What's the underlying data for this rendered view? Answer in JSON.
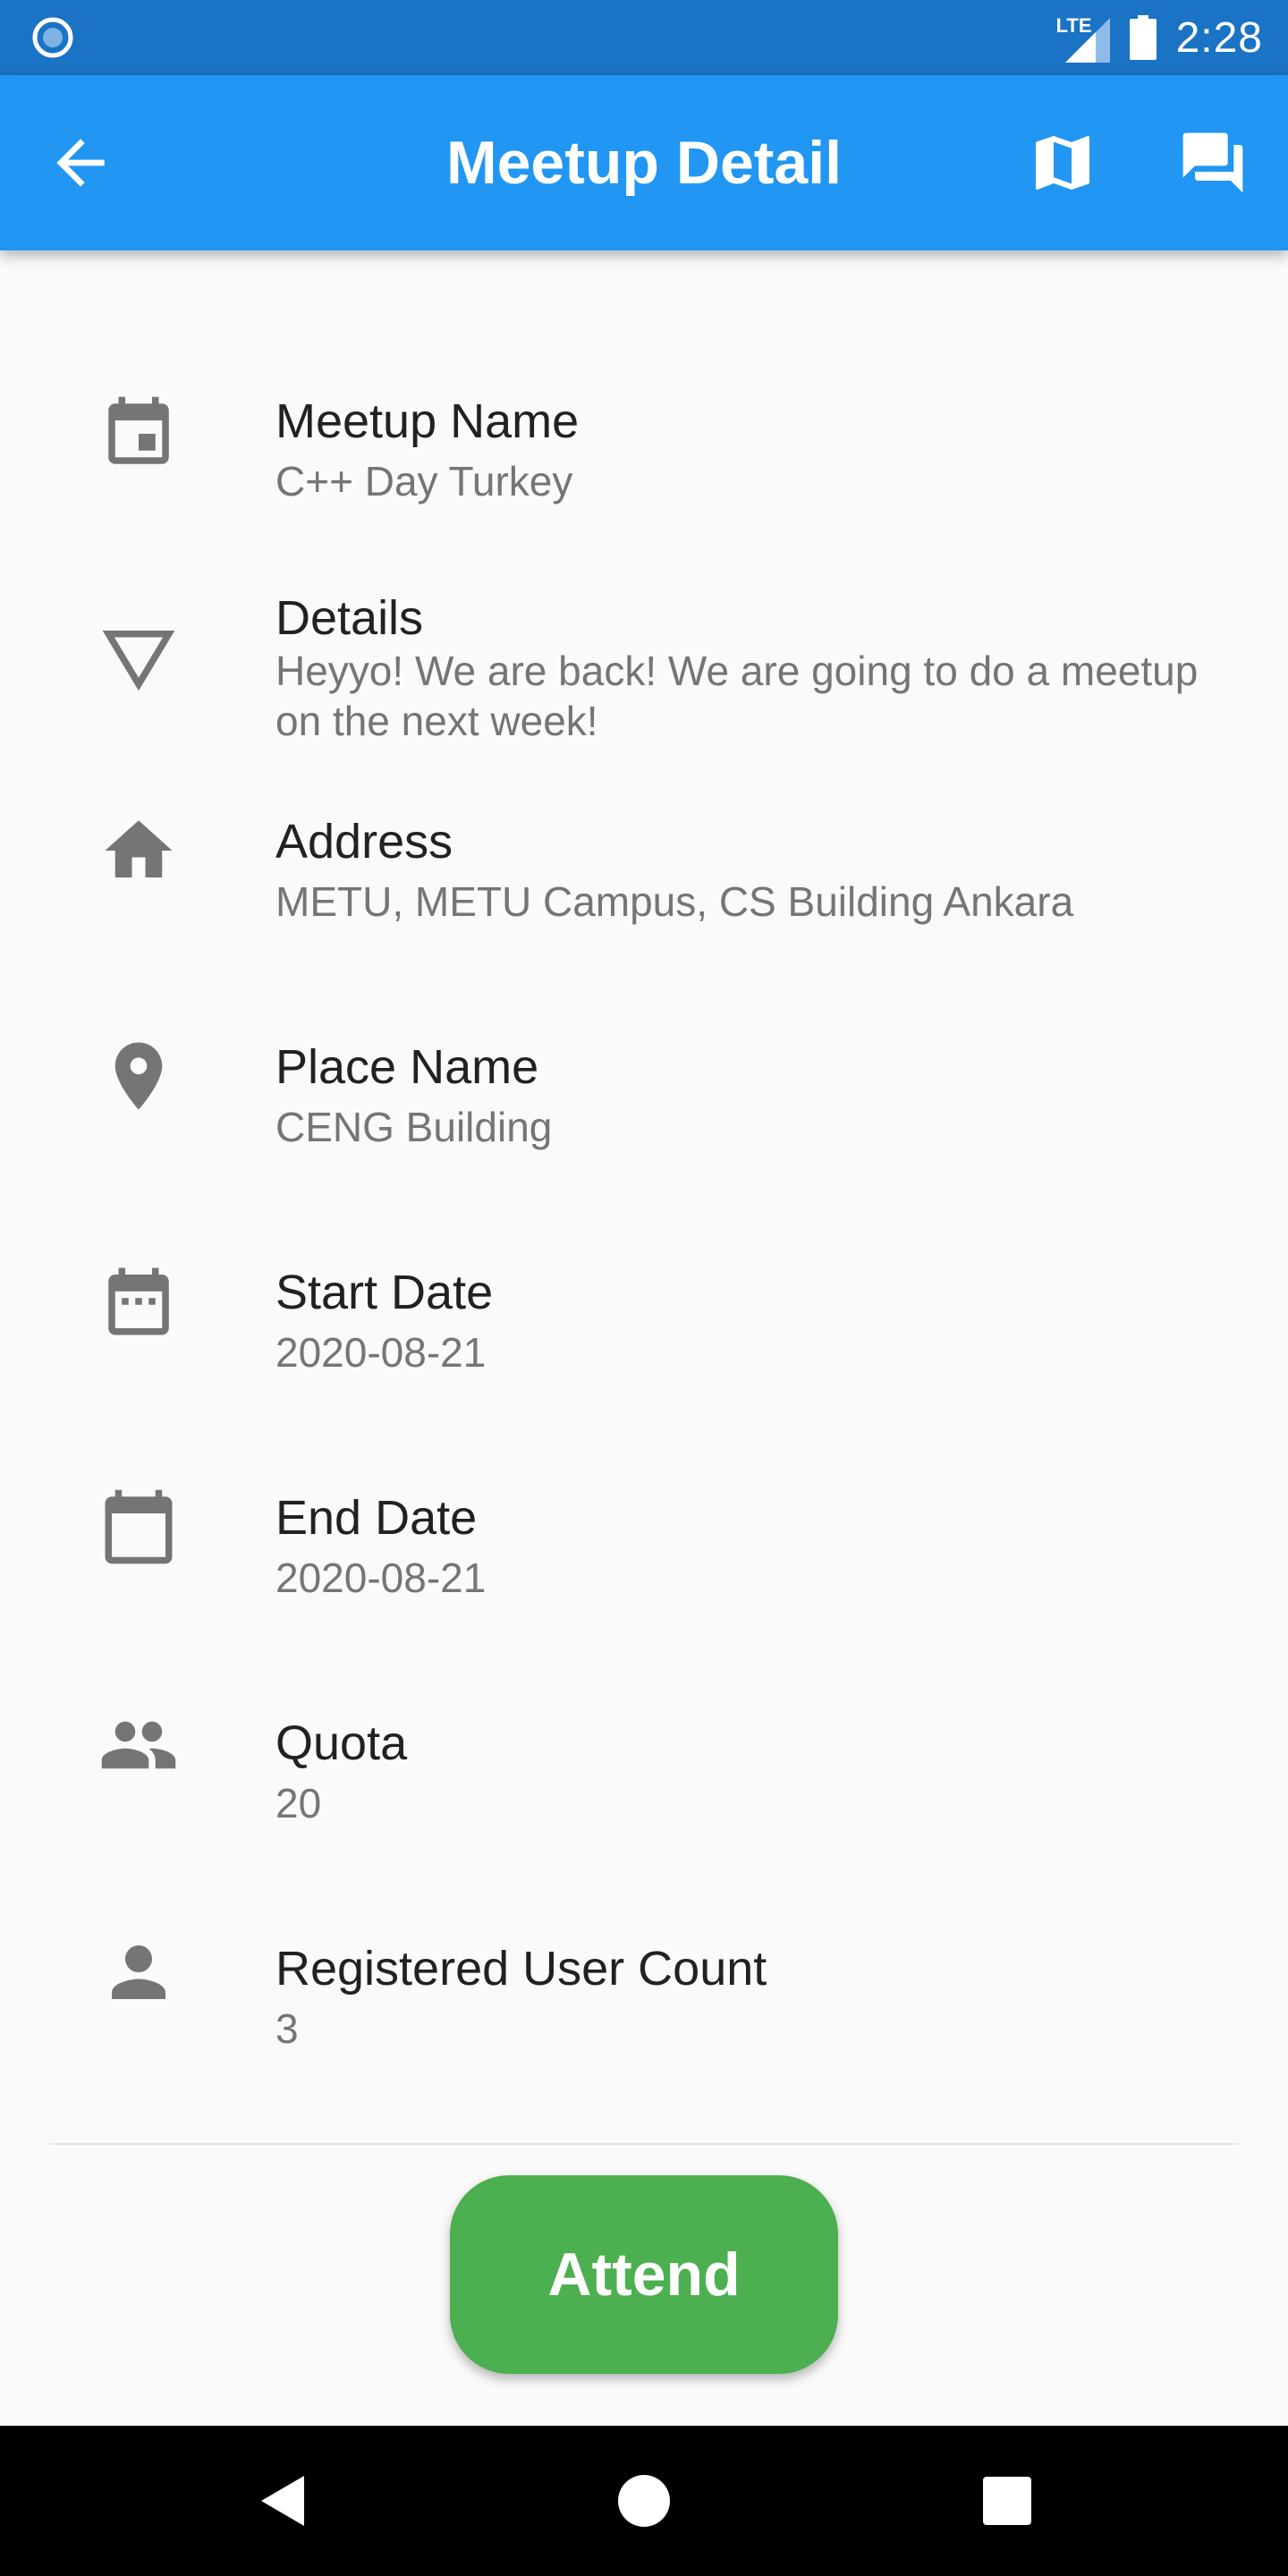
{
  "status_bar": {
    "network": "LTE",
    "time": "2:28",
    "app_icon": "circle-notification-icon",
    "signal_icon": "signal-icon",
    "battery_icon": "battery-icon"
  },
  "app_bar": {
    "title": "Meetup Detail",
    "back_icon": "arrow-back-icon",
    "map_icon": "map-icon",
    "chat_icon": "forum-icon",
    "color": "#2196f3"
  },
  "fields": [
    {
      "icon": "event-icon",
      "label": "Meetup Name",
      "value": "C++ Day Turkey"
    },
    {
      "icon": "triangle-down-outline-icon",
      "label": "Details",
      "value": "Heyyo! We are back! We are going to do a meetup on the next week!"
    },
    {
      "icon": "home-icon",
      "label": "Address",
      "value": "METU, METU Campus, CS Building Ankara"
    },
    {
      "icon": "place-icon",
      "label": "Place Name",
      "value": "CENG Building"
    },
    {
      "icon": "date-range-icon",
      "label": "Start Date",
      "value": "2020-08-21"
    },
    {
      "icon": "calendar-icon",
      "label": "End Date",
      "value": "2020-08-21"
    },
    {
      "icon": "people-icon",
      "label": "Quota",
      "value": "20"
    },
    {
      "icon": "person-icon",
      "label": "Registered User Count",
      "value": "3"
    }
  ],
  "attend_button": {
    "label": "Attend",
    "color": "#4caf50"
  },
  "nav_bar": {
    "back_icon": "nav-back-icon",
    "home_icon": "nav-home-icon",
    "recents_icon": "nav-recents-icon"
  }
}
